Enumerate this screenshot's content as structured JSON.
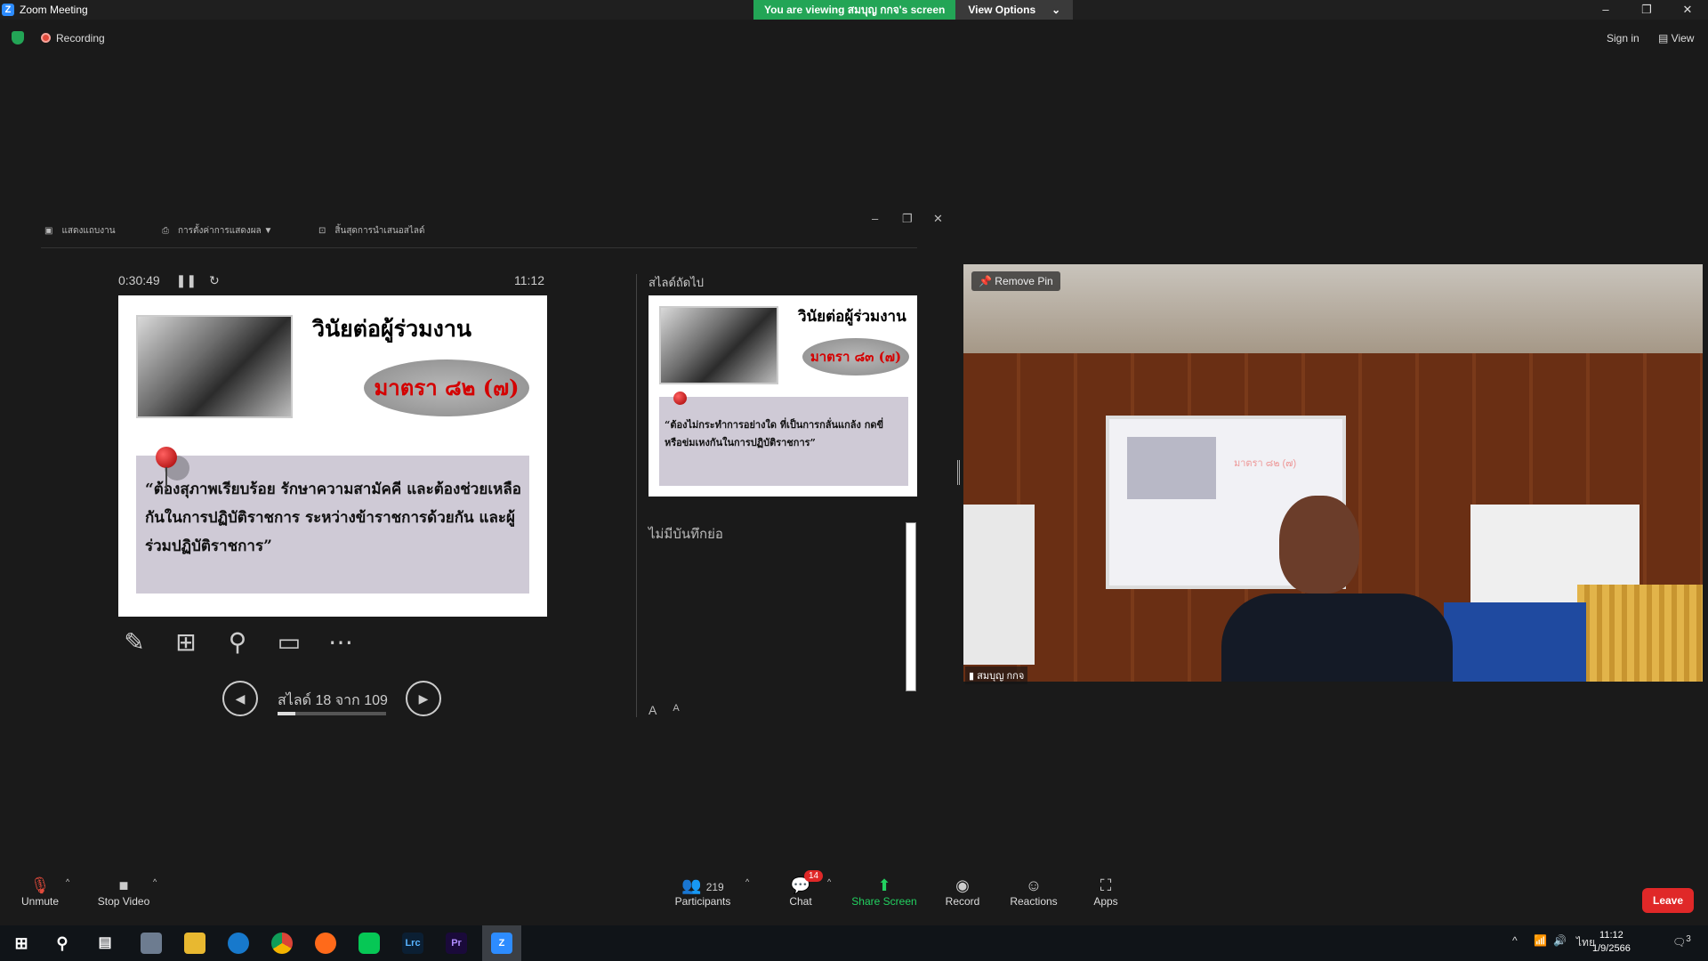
{
  "window": {
    "title": "Zoom Meeting",
    "controls": [
      "–",
      "❐",
      "✕"
    ]
  },
  "banner": {
    "viewing": "You are viewing สมบุญ กกจ's screen",
    "view_options": "View Options",
    "chevron": "⌄"
  },
  "status": {
    "recording": "Recording",
    "sign_in": "Sign in",
    "view": "View"
  },
  "presenter": {
    "toolbar": [
      "แสดงแถบงาน",
      "การตั้งค่าการแสดงผล ▼",
      "สิ้นสุดการนำเสนอสไลด์"
    ],
    "window_controls": [
      "–",
      "❐",
      "✕"
    ],
    "timer": "0:30:49",
    "clock": "11:12",
    "slide": {
      "title": "วินัยต่อผู้ร่วมงาน",
      "section": "มาตรา ๘๒ (๗)",
      "quote": "“ต้องสุภาพเรียบร้อย รักษาความสามัคคี และต้องช่วยเหลือกันในการปฏิบัติราชการ ระหว่างข้าราชการด้วยกัน และผู้ร่วมปฏิบัติราชการ”"
    },
    "next_label": "สไลด์ถัดไป",
    "next_slide": {
      "title": "วินัยต่อผู้ร่วมงาน",
      "section": "มาตรา ๘๓ (๗)",
      "quote": "“ต้องไม่กระทำการอย่างใด ที่เป็นการกลั่นแกล้ง กดขี่ หรือข่มเหงกันในการปฏิบัติราชการ”"
    },
    "notes": "ไม่มีบันทึกย่อ",
    "slide_counter": "สไลด์ 18 จาก 109",
    "progress": 0.165,
    "font_buttons": [
      "A",
      "A"
    ]
  },
  "video": {
    "remove_pin": "Remove Pin",
    "participant_name": "สมบุญ กกจ",
    "screen_text": "มาตรา ๘๒ (๗)"
  },
  "controls": {
    "unmute": "Unmute",
    "stop_video": "Stop Video",
    "participants": "Participants",
    "participant_count": "219",
    "chat": "Chat",
    "chat_badge": "14",
    "share_screen": "Share Screen",
    "record": "Record",
    "reactions": "Reactions",
    "apps": "Apps",
    "leave": "Leave"
  },
  "taskbar": {
    "apps": [
      "Lrc",
      "Pr"
    ],
    "ime": "ไทย",
    "time": "11:12",
    "date": "1/9/2566",
    "notification_count": "3"
  },
  "colors": {
    "green": "#23a556",
    "red": "#e02828",
    "accent": "#2d8cff"
  }
}
